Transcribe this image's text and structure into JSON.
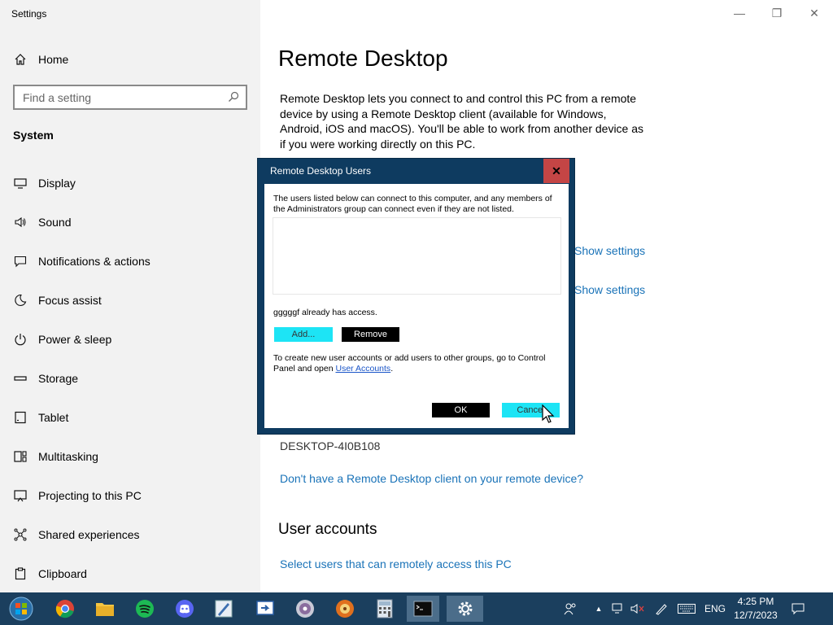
{
  "window": {
    "title": "Settings",
    "controls": {
      "minimize": "—",
      "restore": "❐",
      "close": "✕"
    }
  },
  "sidebar": {
    "home": {
      "label": "Home",
      "icon": "home-icon"
    },
    "search": {
      "placeholder": "Find a setting",
      "value": ""
    },
    "section": "System",
    "items": [
      {
        "label": "Display",
        "icon": "display-icon"
      },
      {
        "label": "Sound",
        "icon": "sound-icon"
      },
      {
        "label": "Notifications & actions",
        "icon": "notifications-icon"
      },
      {
        "label": "Focus assist",
        "icon": "moon-icon"
      },
      {
        "label": "Power & sleep",
        "icon": "power-icon"
      },
      {
        "label": "Storage",
        "icon": "storage-icon"
      },
      {
        "label": "Tablet",
        "icon": "tablet-icon"
      },
      {
        "label": "Multitasking",
        "icon": "multitasking-icon"
      },
      {
        "label": "Projecting to this PC",
        "icon": "projecting-icon"
      },
      {
        "label": "Shared experiences",
        "icon": "shared-icon"
      },
      {
        "label": "Clipboard",
        "icon": "clipboard-icon"
      }
    ]
  },
  "main": {
    "title": "Remote Desktop",
    "description": "Remote Desktop lets you connect to and control this PC from a remote device by using a Remote Desktop client (available for Windows, Android, iOS and macOS). You'll be able to work from another device as if you were working directly on this PC.",
    "show_settings_1": "Show settings",
    "show_settings_2": "Show settings",
    "pc_name": "DESKTOP-4I0B108",
    "no_client_link": "Don't have a Remote Desktop client on your remote device?",
    "user_accounts_heading": "User accounts",
    "select_users_link": "Select users that can remotely access this PC"
  },
  "dialog": {
    "title": "Remote Desktop Users",
    "close": "✕",
    "info": "The users listed below can connect to this computer, and any members of the Administrators group can connect even if they are not listed.",
    "access_status": "gggggf already has access.",
    "add_label": "Add...",
    "remove_label": "Remove",
    "create_info_prefix": "To create new user accounts or add users to other groups, go to Control Panel and open ",
    "create_info_link": "User Accounts",
    "create_info_suffix": ".",
    "ok_label": "OK",
    "cancel_label": "Cancel"
  },
  "taskbar": {
    "apps": [
      "start-icon",
      "chrome-icon",
      "file-explorer-icon",
      "spotify-icon",
      "discord-icon",
      "pen-app-icon",
      "remote-app-icon",
      "disc-app-icon",
      "media-app-icon",
      "calculator-icon",
      "terminal-icon",
      "settings-icon"
    ],
    "language": "ENG",
    "time": "4:25 PM",
    "date": "12/7/2023"
  },
  "colors": {
    "sidebar_bg": "#f2f2f2",
    "link": "#1a73b8",
    "dialog_frame": "#0e3b60",
    "dialog_close": "#c44545",
    "cyan_button": "#1de4f5",
    "taskbar_bg": "#1b3f5e"
  }
}
